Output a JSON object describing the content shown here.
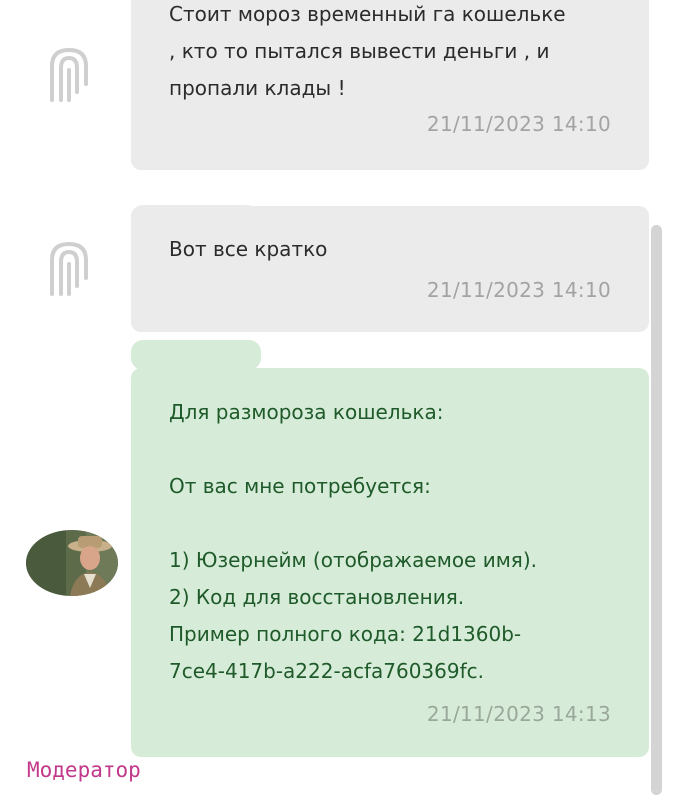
{
  "messages": [
    {
      "sender": "user",
      "text": "Стоит мороз временный га кошельке\n, кто то пытался вывести деньги , и\nпропали клады !",
      "time": "21/11/2023 14:10"
    },
    {
      "sender": "user",
      "text": "Вот все кратко",
      "time": "21/11/2023 14:10"
    },
    {
      "sender": "moderator",
      "text": "Для разморозa кошелька:\n\nОт вас мне потребуется:\n\n1) Юзернейм (отображаемое имя).\n2) Код для восстановления.\nПример полного кода: 21d1360b-\n7ce4-417b-a222-acfa760369fc.",
      "time": "21/11/2023 14:13"
    }
  ],
  "moderator_label": "Модератор",
  "colors": {
    "user_bubble": "#ebebeb",
    "moderator_bubble": "#d6ecd8",
    "moderator_text": "#1f5a2a",
    "timestamp": "#a3a3a3",
    "role_label": "#c2388a"
  },
  "icons": {
    "user_avatar": "placeholder-logo-icon",
    "moderator_avatar": "moderator-photo-avatar"
  }
}
